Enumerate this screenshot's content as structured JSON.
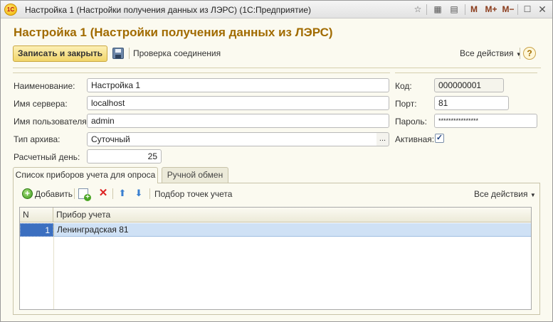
{
  "window": {
    "logo_text": "1С",
    "title": "Настройка 1 (Настройки получения данных из ЛЭРС)  (1С:Предприятие)",
    "buttons": {
      "m": "M",
      "mplus": "M+",
      "mminus": "M−"
    }
  },
  "form": {
    "title": "Настройка 1 (Настройки получения данных из ЛЭРС)"
  },
  "toolbar": {
    "save_close_label": "Записать и закрыть",
    "check_connection_label": "Проверка соединения",
    "all_actions_label": "Все действия",
    "help_label": "?"
  },
  "fields": {
    "name": {
      "label": "Наименование:",
      "value": "Настройка 1"
    },
    "server": {
      "label": "Имя сервера:",
      "value": "localhost"
    },
    "user": {
      "label": "Имя пользователя:",
      "value": "admin"
    },
    "archive_type": {
      "label": "Тип архива:",
      "value": "Суточный",
      "choose": "..."
    },
    "calc_day": {
      "label": "Расчетный день:",
      "value": "25"
    },
    "code": {
      "label": "Код:",
      "value": "000000001"
    },
    "port": {
      "label": "Порт:",
      "value": "81"
    },
    "password": {
      "label": "Пароль:",
      "value": "****************"
    },
    "active": {
      "label": "Активная:",
      "checked": true,
      "check_mark": "✓"
    }
  },
  "tabs": [
    {
      "label": "Список приборов учета для опроса",
      "active": true
    },
    {
      "label": "Ручной обмен",
      "active": false
    }
  ],
  "table_toolbar": {
    "add_label": "Добавить",
    "pick_points_label": "Подбор точек учета",
    "all_actions_label": "Все действия"
  },
  "table": {
    "columns": [
      "N",
      "Прибор учета"
    ],
    "rows": [
      {
        "n": "1",
        "device": "Ленинградская 81",
        "selected": true
      }
    ]
  },
  "colors": {
    "title_accent": "#a16b00",
    "primary_button": "#f1d56a",
    "selection": "#cfe1f5"
  }
}
